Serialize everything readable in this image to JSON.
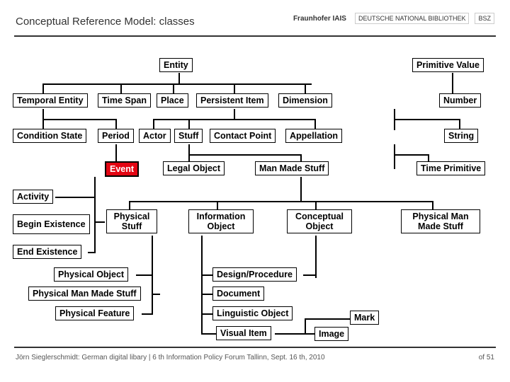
{
  "title": "Conceptual Reference Model: classes",
  "logos": {
    "fraunhofer": "Fraunhofer IAIS",
    "dnb": "DEUTSCHE NATIONAL BIBLIOTHEK",
    "bsz": "BSZ"
  },
  "nodes": {
    "entity": "Entity",
    "primitive_value": "Primitive Value",
    "temporal_entity": "Temporal Entity",
    "time_span": "Time Span",
    "place": "Place",
    "persistent_item": "Persistent Item",
    "dimension": "Dimension",
    "number": "Number",
    "condition_state": "Condition State",
    "period": "Period",
    "actor": "Actor",
    "stuff": "Stuff",
    "contact_point": "Contact Point",
    "appellation": "Appellation",
    "string": "String",
    "event": "Event",
    "legal_object": "Legal Object",
    "man_made_stuff": "Man Made Stuff",
    "time_primitive": "Time Primitive",
    "activity": "Activity",
    "begin_existence": "Begin Existence",
    "physical_stuff": "Physical Stuff",
    "information_object": "Information Object",
    "conceptual_object": "Conceptual Object",
    "physical_man_made_stuff_r": "Physical Man Made Stuff",
    "end_existence": "End Existence",
    "physical_object": "Physical Object",
    "physical_man_made_stuff_l": "Physical Man Made Stuff",
    "physical_feature": "Physical Feature",
    "design_procedure": "Design/Procedure",
    "document": "Document",
    "linguistic_object": "Linguistic Object",
    "visual_item": "Visual Item",
    "mark": "Mark",
    "image": "Image"
  },
  "footer": {
    "left": "Jörn Sieglerschmidt: German digital libary | 6 th Information Policy Forum Tallinn, Sept. 16 th, 2010",
    "right": "of 51"
  }
}
